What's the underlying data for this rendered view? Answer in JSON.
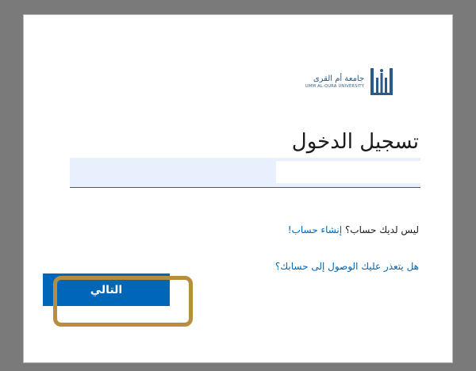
{
  "logo": {
    "arabic": "جامعة أم القرى",
    "english": "UMM AL-QURA UNIVERSITY",
    "brand_color": "#2c5a86"
  },
  "signin": {
    "title": "تسجيل الدخول",
    "input_value": "",
    "no_account_text": "ليس لديك حساب؟",
    "create_account_link": "إنشاء حساب!",
    "cant_access_link": "هل يتعذر عليك الوصول إلى حسابك؟",
    "next_button": "التالي"
  },
  "colors": {
    "accent": "#0067b8",
    "highlight": "#b88d3d",
    "input_bg": "#e8f0fe"
  }
}
